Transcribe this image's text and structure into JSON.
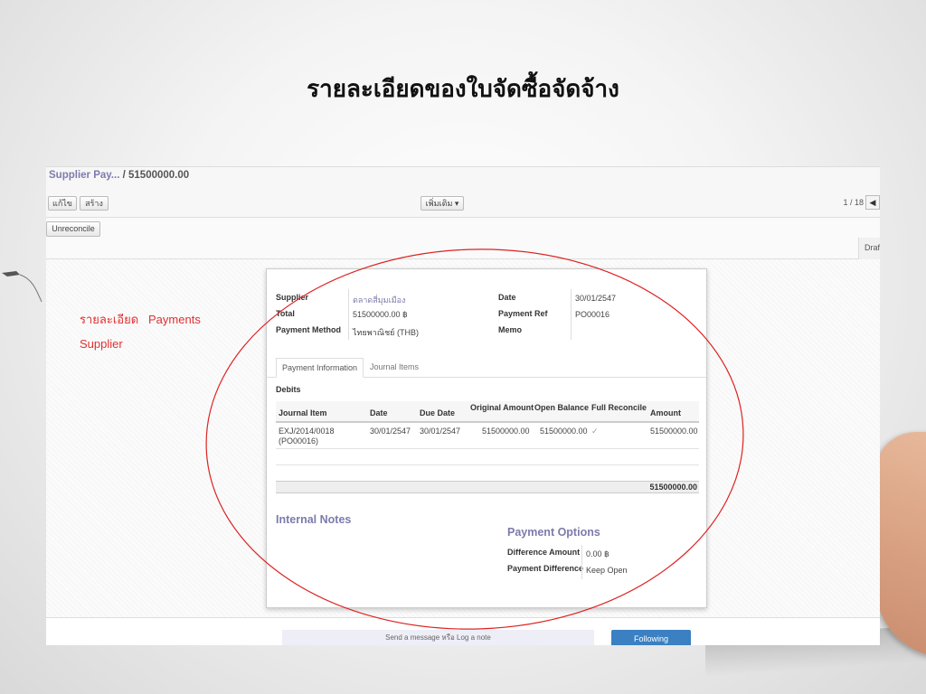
{
  "slide_title": "รายละเอียดของใบจัดซื้อจัดจ้าง",
  "annotation": {
    "line1_th": "รายละเอียด",
    "line1_en": "Payments",
    "line2": "Supplier"
  },
  "colors": {
    "accent": "#7c7bad",
    "annotation_red": "#e03030",
    "follow_blue": "#3a80c3"
  },
  "breadcrumb": {
    "parent": "Supplier Pay...",
    "separator": "/",
    "current": "51500000.00"
  },
  "toolbar": {
    "edit_label": "แก้ไข",
    "create_label": "สร้าง",
    "more_label": "เพิ่มเติม ▾",
    "pager": "1 / 18",
    "prev_icon": "◀"
  },
  "actions": {
    "unreconcile_label": "Unreconcile",
    "status": "Draf"
  },
  "form": {
    "supplier_label": "Supplier",
    "supplier_value": "ตลาดสี่มุมเมือง",
    "total_label": "Total",
    "total_value": "51500000.00 ฿",
    "method_label": "Payment Method",
    "method_value": "ไทยพาณิชย์ (THB)",
    "date_label": "Date",
    "date_value": "30/01/2547",
    "ref_label": "Payment Ref",
    "ref_value": "PO00016",
    "memo_label": "Memo",
    "memo_value": ""
  },
  "tabs": [
    "Payment Information",
    "Journal Items"
  ],
  "debits": {
    "title": "Debits",
    "columns": [
      "Journal Item",
      "Date",
      "Due Date",
      "Original Amount",
      "Open Balance",
      "Full Reconcile",
      "Amount"
    ],
    "row": {
      "journal_item_1": "EXJ/2014/0018",
      "journal_item_2": "(PO00016)",
      "date": "30/01/2547",
      "due_date": "30/01/2547",
      "original_amount": "51500000.00",
      "open_balance": "51500000.00",
      "full_reconcile": "✓",
      "amount": "51500000.00"
    },
    "total": "51500000.00"
  },
  "internal_notes_title": "Internal Notes",
  "payment_options": {
    "title": "Payment Options",
    "difference_label": "Difference Amount",
    "difference_value": "0.00 ฿",
    "payment_diff_label": "Payment Difference",
    "payment_diff_value": "Keep Open"
  },
  "chatter": {
    "send_message": "Send a message",
    "or": "หรือ",
    "log_note": "Log a note",
    "following": "Following"
  }
}
